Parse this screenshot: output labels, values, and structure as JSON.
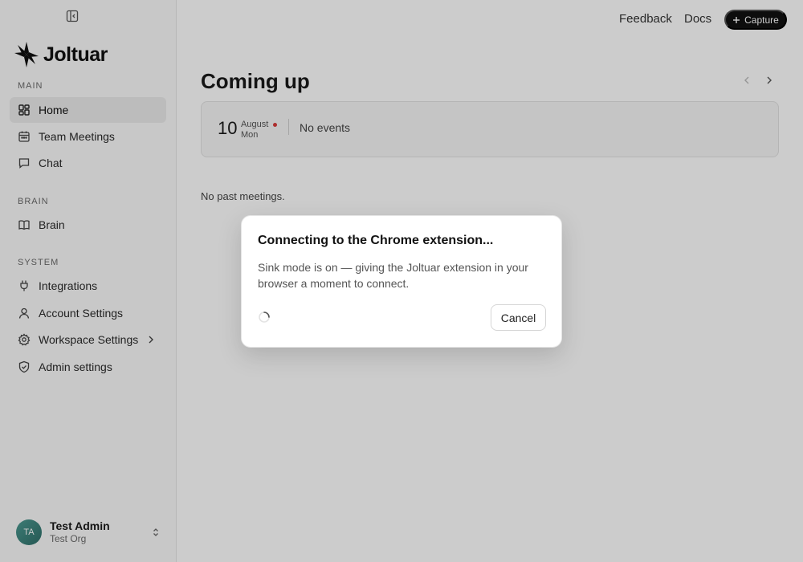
{
  "sidebar": {
    "brand": "Joltuar",
    "sections": {
      "main": "MAIN",
      "brain": "BRAIN",
      "system": "SYSTEM"
    },
    "items": {
      "home": "Home",
      "team_meetings": "Team Meetings",
      "chat": "Chat",
      "brain": "Brain",
      "integrations": "Integrations",
      "account_settings": "Account Settings",
      "workspace_settings": "Workspace Settings",
      "admin_settings": "Admin settings"
    },
    "user": {
      "initials": "TA",
      "name": "Test Admin",
      "org": "Test Org"
    }
  },
  "topbar": {
    "feedback": "Feedback",
    "docs": "Docs",
    "capture": "Capture"
  },
  "main": {
    "title": "Coming up",
    "day_number": "10",
    "month": "August",
    "weekday": "Mon",
    "no_events": "No events",
    "no_past": "No past meetings."
  },
  "modal": {
    "title": "Connecting to the Chrome extension...",
    "body": "Sink mode is on — giving the Joltuar extension in your browser a moment to connect.",
    "cancel": "Cancel"
  },
  "colors": {
    "accent_dark": "#111111",
    "today_dot": "#d93a3a",
    "avatar": "#3f8a83"
  },
  "icons": {
    "sidebar_toggle": "sidebar-toggle-icon",
    "home": "grid-icon",
    "team_meetings": "calendar-icon",
    "chat": "chat-bubble-icon",
    "brain": "book-icon",
    "integrations": "plug-icon",
    "account_settings": "user-icon",
    "workspace_settings": "gear-icon",
    "admin_settings": "shield-check-icon",
    "capture": "plus-icon"
  }
}
